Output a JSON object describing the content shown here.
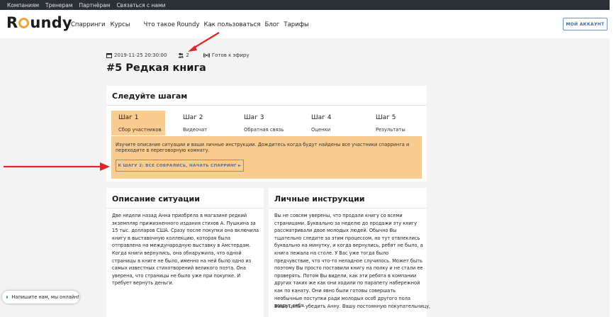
{
  "topbar": {
    "links": [
      "Компаниям",
      "Тренерам",
      "Партнёрам",
      "Связаться с нами"
    ]
  },
  "nav": {
    "logo": "Roundy",
    "links": [
      "Спарринги",
      "Курсы",
      "Что такое Roundy",
      "Как пользоваться",
      "Блог",
      "Тарифы"
    ],
    "account_button": "МОЙ АККАУНТ"
  },
  "meta": {
    "datetime": "2019-11-25 20:30:00",
    "participants": "2",
    "status": "Готов к эфиру"
  },
  "title": "#5 Редкая книга",
  "steps_card": {
    "title": "Следуйте шагам",
    "steps": [
      {
        "num": "Шаг 1",
        "label": "Сбор участников",
        "active": true
      },
      {
        "num": "Шаг 2",
        "label": "Видеочат",
        "active": false
      },
      {
        "num": "Шаг 3",
        "label": "Обратная связь",
        "active": false
      },
      {
        "num": "Шаг 4",
        "label": "Оценки",
        "active": false
      },
      {
        "num": "Шаг 5",
        "label": "Результаты",
        "active": false
      }
    ],
    "info_text": "Изучите описание ситуации и ваши личные инструкции. Дождитесь когда будут найдены все участники спарринга и переходите в переговорную комнату.",
    "next_button": "К ШАГУ 2: ВСЕ СОБРАЛИСЬ, НАЧАТЬ СПАРРИНГ ►"
  },
  "description": {
    "title": "Описание ситуации",
    "text": "Две недели назад Анна приобрела в магазине редкий экземпляр прижизненного издания стихов А. Пушкина за 15 тыс. долларов США. Сразу после покупки она включила книгу в выставочную коллекцию, которая была отправлена на международную выставку в Амстердам. Когда книги вернулись, она обнаружила, что одной страницы в книге не было, именно на ней было одно из самых известных стихотворений великого поэта. Она уверена, что страницы не было уже при покупке. И требует вернуть деньги."
  },
  "instructions": {
    "title": "Личные инструкции",
    "text": "Вы не совсем уверены, что продали книгу со всеми страницами. Буквально за неделю до продажи эту книгу рассматривали двое молодых людей. Обычно Вы тщательно следите за этим процессом, но тут отвлеклись буквально на минутку, и когда вернулись, ребят не было, а книга лежала на столе. У Вас уже тогда было предчувствие, что что-то неладное случилось. Может быть поэтому Вы просто поставили книгу на полку и не стали ее проверять. Потом Вы видели, как эти ребята в компании других таких же как они ходили по парапету набережной как по канату. Они явно были готовы совершать необычные поступки ради молодых особ другого пола вокруг себя.",
    "text2": "Ваша цель - убедить Анну. Вашу постоянную покупательницу,"
  },
  "chat": {
    "label": "Напишите нам, мы онлайн!"
  },
  "colors": {
    "accent": "#fbcc8f",
    "arrow": "#e0262b",
    "topbar": "#2b2f36",
    "online": "#33b44a"
  }
}
